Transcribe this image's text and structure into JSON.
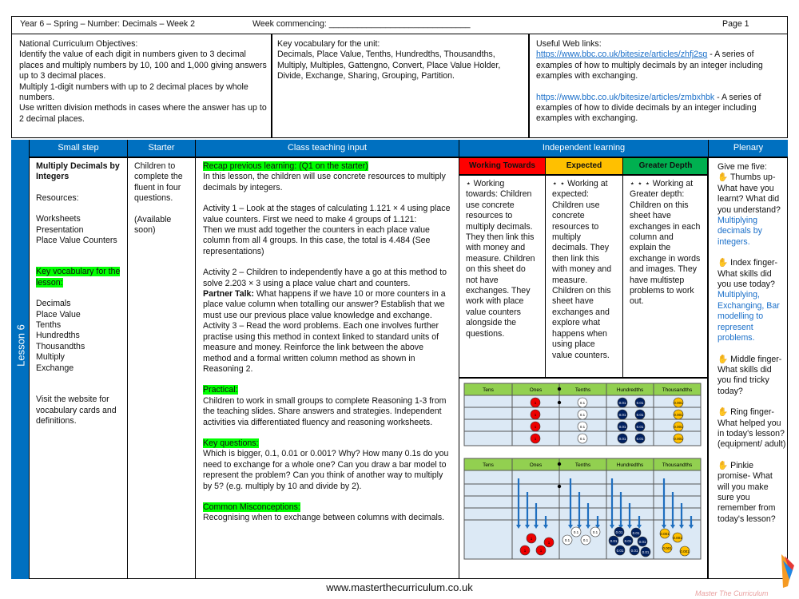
{
  "header": {
    "title": "Year 6 – Spring – Number: Decimals – Week 2",
    "week_commencing": "Week commencing: ______________________________",
    "page": "Page 1"
  },
  "objectives": {
    "heading": "National Curriculum Objectives:",
    "lines": [
      "Identify the value of each digit in numbers given to 3 decimal places and multiply numbers by 10, 100 and 1,000 giving answers up to 3 decimal places.",
      "Multiply 1-digit numbers with up to 2 decimal places by whole numbers.",
      "Use written division methods in cases where the answer has up to 2 decimal places."
    ]
  },
  "unit_vocab": {
    "heading": "Key vocabulary for the unit:",
    "text": "Decimals, Place Value, Tenths, Hundredths, Thousandths, Multiply, Multiples, Gattengno, Convert, Place Value Holder, Divide, Exchange, Sharing, Grouping, Partition."
  },
  "links": {
    "heading": "Useful Web links:",
    "items": [
      {
        "url": "https://www.bbc.co.uk/bitesize/articles/zhfj2sg",
        "desc": " - A series of examples of how to multiply decimals by an integer including examples with exchanging."
      },
      {
        "url": "https://www.bbc.co.uk/bitesize/articles/zmbxhbk",
        "desc": " - A series of examples  of how to divide decimals by an integer including examples with exchanging."
      }
    ]
  },
  "columns": {
    "lesson": "Lesson 6",
    "small_step": "Small step",
    "starter": "Starter",
    "teaching": "Class teaching input",
    "independent": "Independent learning",
    "plenary": "Plenary"
  },
  "small_step": {
    "title": "Multiply Decimals by Integers",
    "resources_label": "Resources:",
    "resources": [
      "Worksheets",
      "Presentation",
      "Place Value Counters"
    ],
    "vocab_label": "Key vocabulary for the lesson:",
    "vocab": [
      "Decimals",
      "Place Value",
      "Tenths",
      "Hundredths",
      "Thousandths",
      "Multiply",
      "Exchange"
    ],
    "visit": "Visit the website for vocabulary cards and definitions."
  },
  "starter": {
    "text": "Children to complete the fluent in four questions.",
    "note": "(Available soon)"
  },
  "teaching": {
    "recap": "Recap previous learning: (Q1 on the starter)",
    "intro": "In this lesson, the children will use concrete resources to multiply decimals by integers.",
    "activity1": "Activity 1 – Look at the stages of calculating 1.121 × 4 using place value counters. First we need to make 4 groups of 1.121:",
    "activity1b": "Then we must add together the counters in each place value column from all 4 groups. In this case, the total is 4.484 (See representations)",
    "activity2": "Activity 2 – Children to independently have a go at this method to solve 2.203 × 3 using a place value chart and counters.",
    "partner_label": "Partner Talk:",
    "partner": " What happens if we have 10 or more counters in a place value column when totalling our answer? Establish that we must use our previous place value knowledge and exchange.",
    "activity3": "Activity 3 – Read the word problems. Each one involves further practise using this method in context linked to standard units of measure and money. Reinforce the link between the above method and a formal written column method as shown in Reasoning 2.",
    "practical_label": "Practical:",
    "practical": "Children to work in small groups to complete Reasoning 1-3 from the teaching slides. Share answers and strategies. Independent activities via differentiated fluency and reasoning worksheets.",
    "kq_label": "Key questions:",
    "kq": "Which is bigger, 0.1, 0.01 or 0.001? Why? How many 0.1s do you need to exchange for a whole one? Can you draw a bar model to represent the problem? Can you think of another way to multiply by 5? (e.g. multiply by 10 and divide by 2).",
    "misc_label": "Common Misconceptions:",
    "misc": "Recognising when to exchange between columns with decimals."
  },
  "independent": {
    "levels": [
      {
        "label": "Working Towards",
        "color": "#ff0000",
        "stars": "⋆",
        "text": " Working towards: Children use concrete resources to multiply decimals. They then link this with money and measure. Children on this sheet do not have exchanges. They work with place value counters alongside the questions."
      },
      {
        "label": "Expected",
        "color": "#ffc000",
        "stars": "⋆ ⋆",
        "text": " Working at expected: Children use concrete resources to multiply decimals. They then link this with money and measure. Children on this sheet have exchanges and explore what happens when using place value counters."
      },
      {
        "label": "Greater Depth",
        "color": "#00b050",
        "stars": "⋆ ⋆ ⋆",
        "text": " Working at Greater depth: Children on this sheet have exchanges in each column and explain the exchange in words and images. They have multistep problems to work out."
      }
    ]
  },
  "place_value": {
    "headers": [
      "Tens",
      "Ones",
      "Tenths",
      "Hundredths",
      "Thousandths"
    ],
    "counters": {
      "ones": "1",
      "tenths": "0.1",
      "hundredths": "0.01",
      "thousandths": "0.001"
    },
    "colors": {
      "header": "#92d050",
      "cell": "#dce9f5",
      "ones": "#ee0000",
      "tenths": "#ffffff",
      "hundredths": "#002060",
      "thousandths": "#ffc000",
      "arrow": "#1f6fbf"
    }
  },
  "plenary": {
    "intro": "Give me five:",
    "items": [
      {
        "lead": "Thumbs up- What have you learnt? What did you understand?",
        "answer": "Multiplying decimals by integers."
      },
      {
        "lead": "Index finger- What skills did you use today?",
        "answer": "Multiplying, Exchanging, Bar modelling to represent problems."
      },
      {
        "lead": "Middle finger- What skills did you find tricky today?",
        "answer": ""
      },
      {
        "lead": "Ring finger- What helped you in today's lesson? (equipment/ adult)",
        "answer": ""
      },
      {
        "lead": "Pinkie promise- What will you make sure you remember from today's lesson?",
        "answer": ""
      }
    ]
  },
  "footer": {
    "url": "www.masterthecurriculum.co.uk",
    "logo_text": "Master The Curriculum"
  }
}
